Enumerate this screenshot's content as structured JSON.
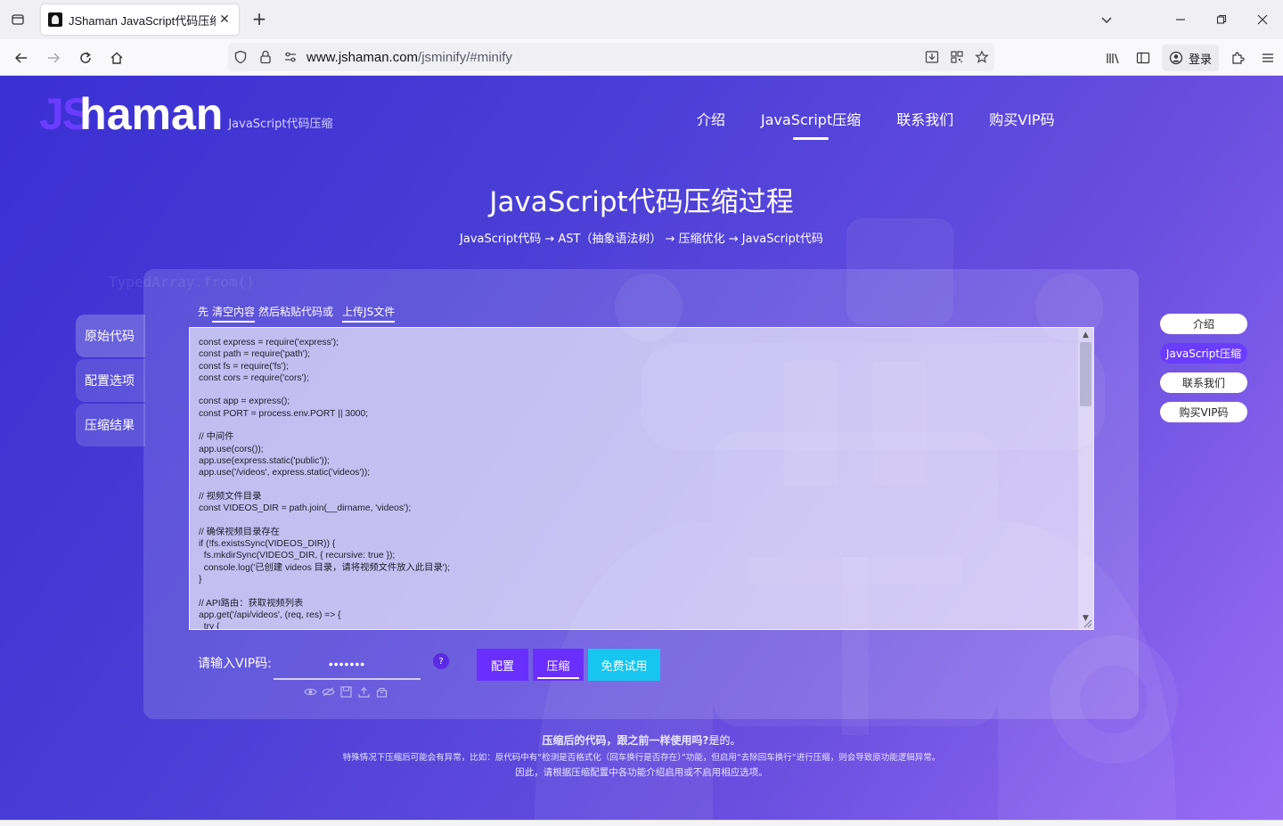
{
  "browser": {
    "tab_title": "JShaman JavaScript代码压缩",
    "url_host": "www.jshaman.com",
    "url_path": "/jsminify/#minify",
    "login_label": "登录"
  },
  "site": {
    "logo_js": "JS",
    "logo_name": "haman",
    "logo_sub": "JavaScript代码压缩",
    "nav": [
      {
        "label": "介绍",
        "active": false
      },
      {
        "label": "JavaScript压缩",
        "active": true
      },
      {
        "label": "联系我们",
        "active": false
      },
      {
        "label": "购买VIP码",
        "active": false
      }
    ]
  },
  "hero": {
    "title": "JavaScript代码压缩过程",
    "subtitle": "JavaScript代码 → AST（抽象语法树） → 压缩优化 → JavaScript代码"
  },
  "background_text": "TypedArray.from()",
  "sidetabs": [
    "原始代码",
    "配置选项",
    "压缩结果"
  ],
  "hint": {
    "prefix": "先",
    "clear": "清空内容",
    "middle": "然后粘贴代码或",
    "upload": "上传JS文件"
  },
  "code": "const express = require('express');\nconst path = require('path');\nconst fs = require('fs');\nconst cors = require('cors');\n\nconst app = express();\nconst PORT = process.env.PORT || 3000;\n\n// 中间件\napp.use(cors());\napp.use(express.static('public'));\napp.use('/videos', express.static('videos'));\n\n// 视频文件目录\nconst VIDEOS_DIR = path.join(__dirname, 'videos');\n\n// 确保视频目录存在\nif (!fs.existsSync(VIDEOS_DIR)) {\n  fs.mkdirSync(VIDEOS_DIR, { recursive: true });\n  console.log('已创建 videos 目录，请将视频文件放入此目录');\n}\n\n// API路由：获取视频列表\napp.get('/api/videos', (req, res) => {\n  try {",
  "vip": {
    "label": "请输入VIP码:",
    "value": "•••••••",
    "help": "?"
  },
  "buttons": {
    "config": "配置",
    "compress": "压缩",
    "trial": "免费试用"
  },
  "rightnav": [
    {
      "label": "介绍",
      "active": false
    },
    {
      "label": "JavaScript压缩",
      "active": true
    },
    {
      "label": "联系我们",
      "active": false
    },
    {
      "label": "购买VIP码",
      "active": false
    }
  ],
  "footer": {
    "question": "压缩后的代码，跟之前一样使用吗?",
    "answer": "是的。",
    "line1": "特殊情况下压缩后可能会有异常，比如：原代码中有“检测是否格式化（回车换行是否存在）”功能，但启用“去除回车换行”进行压缩，则会导致原功能逻辑异常。",
    "line2": "因此，请根据压缩配置中各功能介绍启用或不启用相应选项。"
  },
  "colors": {
    "accent": "#6a2eff",
    "trial": "#16c6f0",
    "bg_start": "#3a2fd2",
    "bg_end": "#9a6cf4"
  }
}
